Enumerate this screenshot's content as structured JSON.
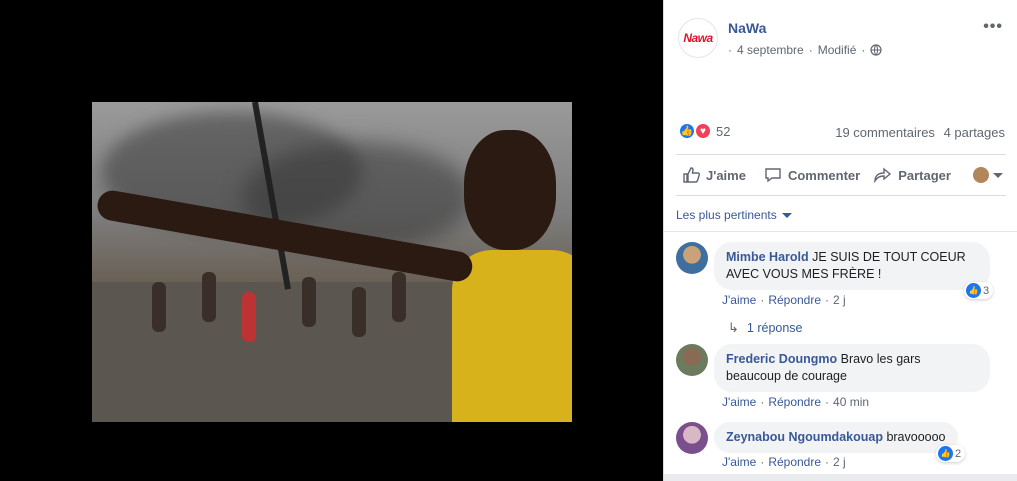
{
  "post": {
    "page_name": "NaWa",
    "logo_text": "Nawa",
    "date": "4 septembre",
    "separator": "·",
    "edited": "Modifié",
    "more": "•••"
  },
  "reactions": {
    "count": "52",
    "comments": "19 commentaires",
    "shares": "4 partages"
  },
  "actions": {
    "like": "J'aime",
    "comment": "Commenter",
    "share": "Partager"
  },
  "filter": {
    "label": "Les plus pertinents"
  },
  "comments": [
    {
      "author": "Mimbe Harold",
      "text": "JE SUIS DE TOUT COEUR AVEC VOUS MES FRÈRE !",
      "like": "J'aime",
      "reply": "Répondre",
      "time": "2 j",
      "reactions": "3",
      "replies": "1 réponse"
    },
    {
      "author": "Frederic Doungmo",
      "text": "Bravo les gars beaucoup de courage",
      "like": "J'aime",
      "reply": "Répondre",
      "time": "40 min"
    },
    {
      "author": "Zeynabou Ngoumdakouap",
      "text": "bravooooo",
      "like": "J'aime",
      "reply": "Répondre",
      "time": "2 j",
      "reactions": "2"
    }
  ],
  "colors": {
    "link": "#385898",
    "like": "#1877f2",
    "love": "#f33e58",
    "text_secondary": "#606770"
  }
}
